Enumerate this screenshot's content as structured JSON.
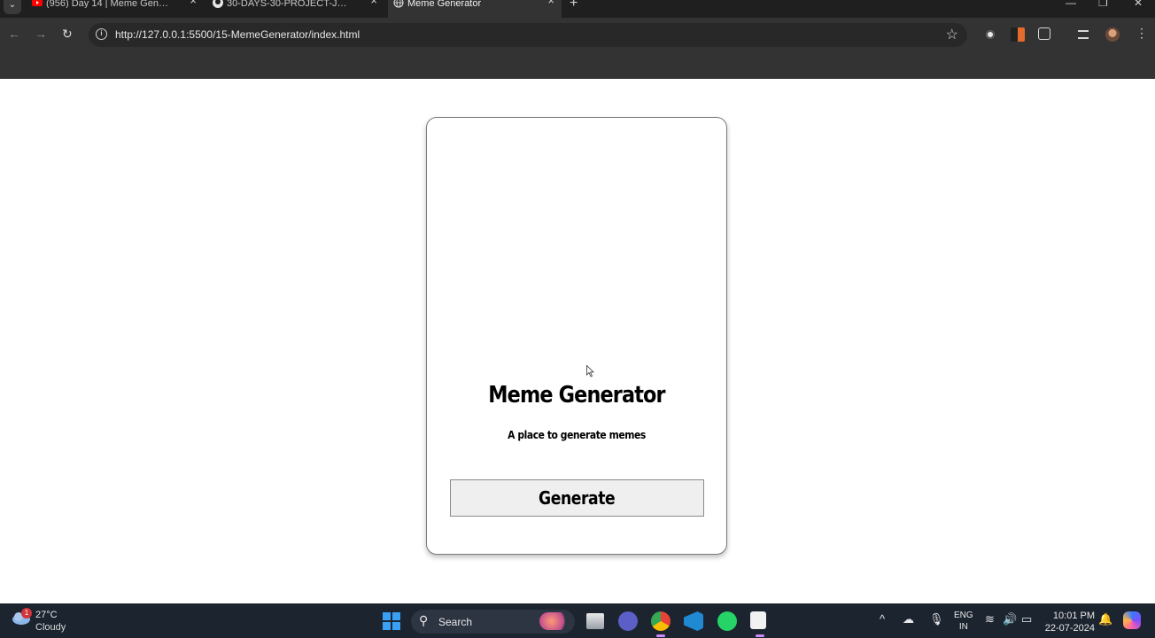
{
  "browser": {
    "tabs": [
      {
        "title": "(956) Day 14 | Meme Generator",
        "icon": "youtube-icon"
      },
      {
        "title": "30-DAYS-30-PROJECT-JS/15-M",
        "icon": "github-icon"
      },
      {
        "title": "Meme Generator",
        "icon": "globe-icon"
      }
    ],
    "url": "http://127.0.0.1:5500/15-MemeGenerator/index.html"
  },
  "app": {
    "title": "Meme Generator",
    "tagline": "A place to generate memes",
    "generate_label": "Generate"
  },
  "taskbar": {
    "weather_temp": "27°C",
    "weather_desc": "Cloudy",
    "weather_badge": "1",
    "search_label": "Search",
    "lang_top": "ENG",
    "lang_bottom": "IN",
    "time": "10:01 PM",
    "date": "22-07-2024"
  },
  "colors": {
    "accent_windows": "#3aa0f3",
    "chrome_dark": "#333333",
    "taskbar_bg": "#1c2430"
  }
}
